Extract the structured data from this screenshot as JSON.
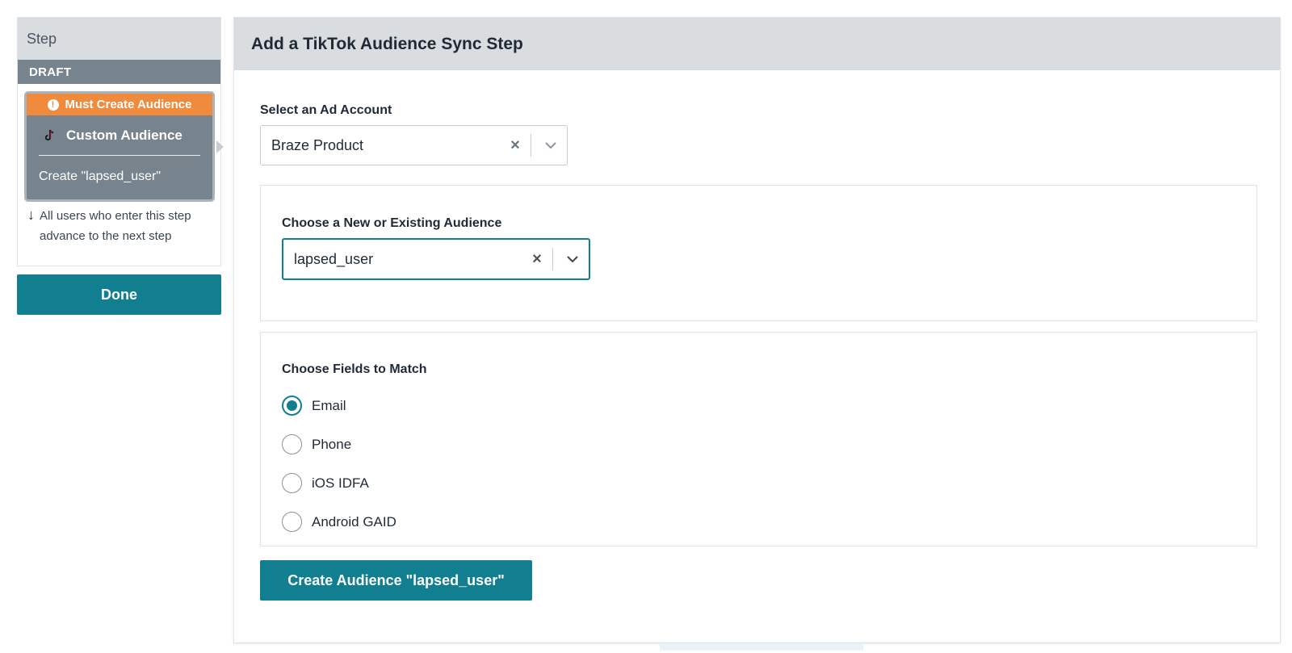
{
  "step_panel": {
    "header": "Step",
    "status": "DRAFT",
    "card": {
      "warning": "Must Create Audience",
      "title": "Custom Audience",
      "description": "Create \"lapsed_user\""
    },
    "advance_note": "All users who enter this step advance to the next step",
    "done_label": "Done"
  },
  "modal": {
    "title": "Add a TikTok Audience Sync Step",
    "ad_account": {
      "label": "Select an Ad Account",
      "value": "Braze Product"
    },
    "audience": {
      "label": "Choose a New or Existing Audience",
      "value": "lapsed_user"
    },
    "match_fields": {
      "label": "Choose Fields to Match",
      "options": [
        "Email",
        "Phone",
        "iOS IDFA",
        "Android GAID"
      ],
      "selected": "Email"
    },
    "create_label": "Create Audience \"lapsed_user\""
  },
  "colors": {
    "accent": "#127f91",
    "warning": "#f08a3c",
    "card_bg": "#77848d",
    "header_bg": "#dadde0"
  }
}
